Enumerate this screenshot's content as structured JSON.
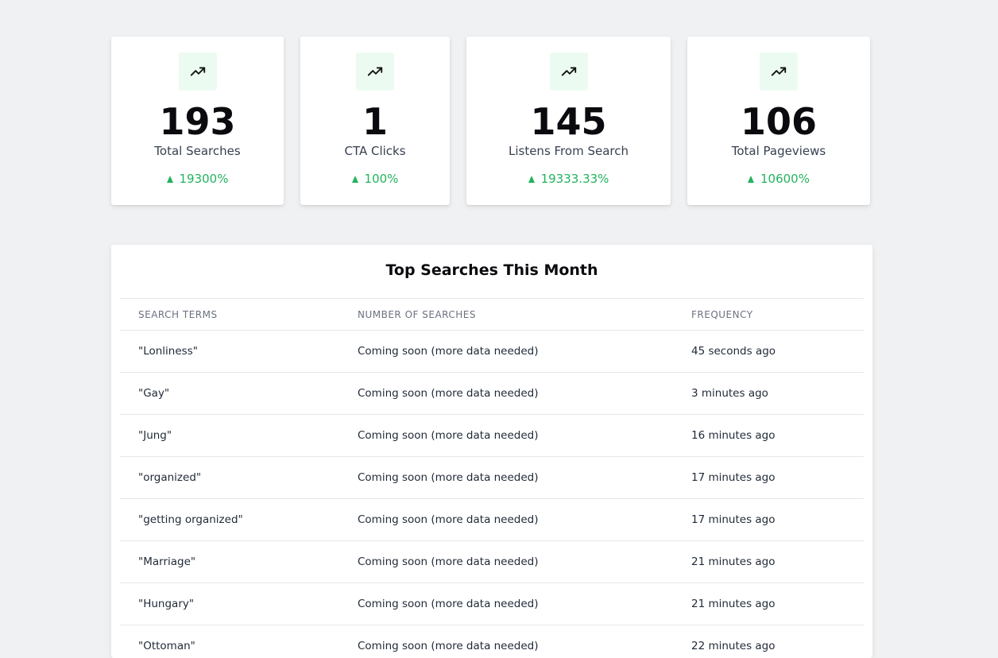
{
  "stats": [
    {
      "value": "193",
      "label": "Total Searches",
      "change": "19300%",
      "icon": "trending-up-icon",
      "accent": "#22b35e"
    },
    {
      "value": "1",
      "label": "CTA Clicks",
      "change": "100%",
      "icon": "trending-up-icon",
      "accent": "#22b35e"
    },
    {
      "value": "145",
      "label": "Listens From Search",
      "change": "19333.33%",
      "icon": "trending-up-icon",
      "accent": "#22b35e"
    },
    {
      "value": "106",
      "label": "Total Pageviews",
      "change": "10600%",
      "icon": "trending-up-icon",
      "accent": "#22b35e"
    }
  ],
  "top_searches": {
    "title": "Top Searches This Month",
    "columns": [
      "SEARCH TERMS",
      "NUMBER OF SEARCHES",
      "FREQUENCY"
    ],
    "rows": [
      {
        "term": "\"Lonliness\"",
        "count": "Coming soon (more data needed)",
        "frequency": "45 seconds ago"
      },
      {
        "term": "\"Gay\"",
        "count": "Coming soon (more data needed)",
        "frequency": "3 minutes ago"
      },
      {
        "term": "\"Jung\"",
        "count": "Coming soon (more data needed)",
        "frequency": "16 minutes ago"
      },
      {
        "term": "\"organized\"",
        "count": "Coming soon (more data needed)",
        "frequency": "17 minutes ago"
      },
      {
        "term": "\"getting organized\"",
        "count": "Coming soon (more data needed)",
        "frequency": "17 minutes ago"
      },
      {
        "term": "\"Marriage\"",
        "count": "Coming soon (more data needed)",
        "frequency": "21 minutes ago"
      },
      {
        "term": "\"Hungary\"",
        "count": "Coming soon (more data needed)",
        "frequency": "21 minutes ago"
      },
      {
        "term": "\"Ottoman\"",
        "count": "Coming soon (more data needed)",
        "frequency": "22 minutes ago"
      }
    ]
  }
}
